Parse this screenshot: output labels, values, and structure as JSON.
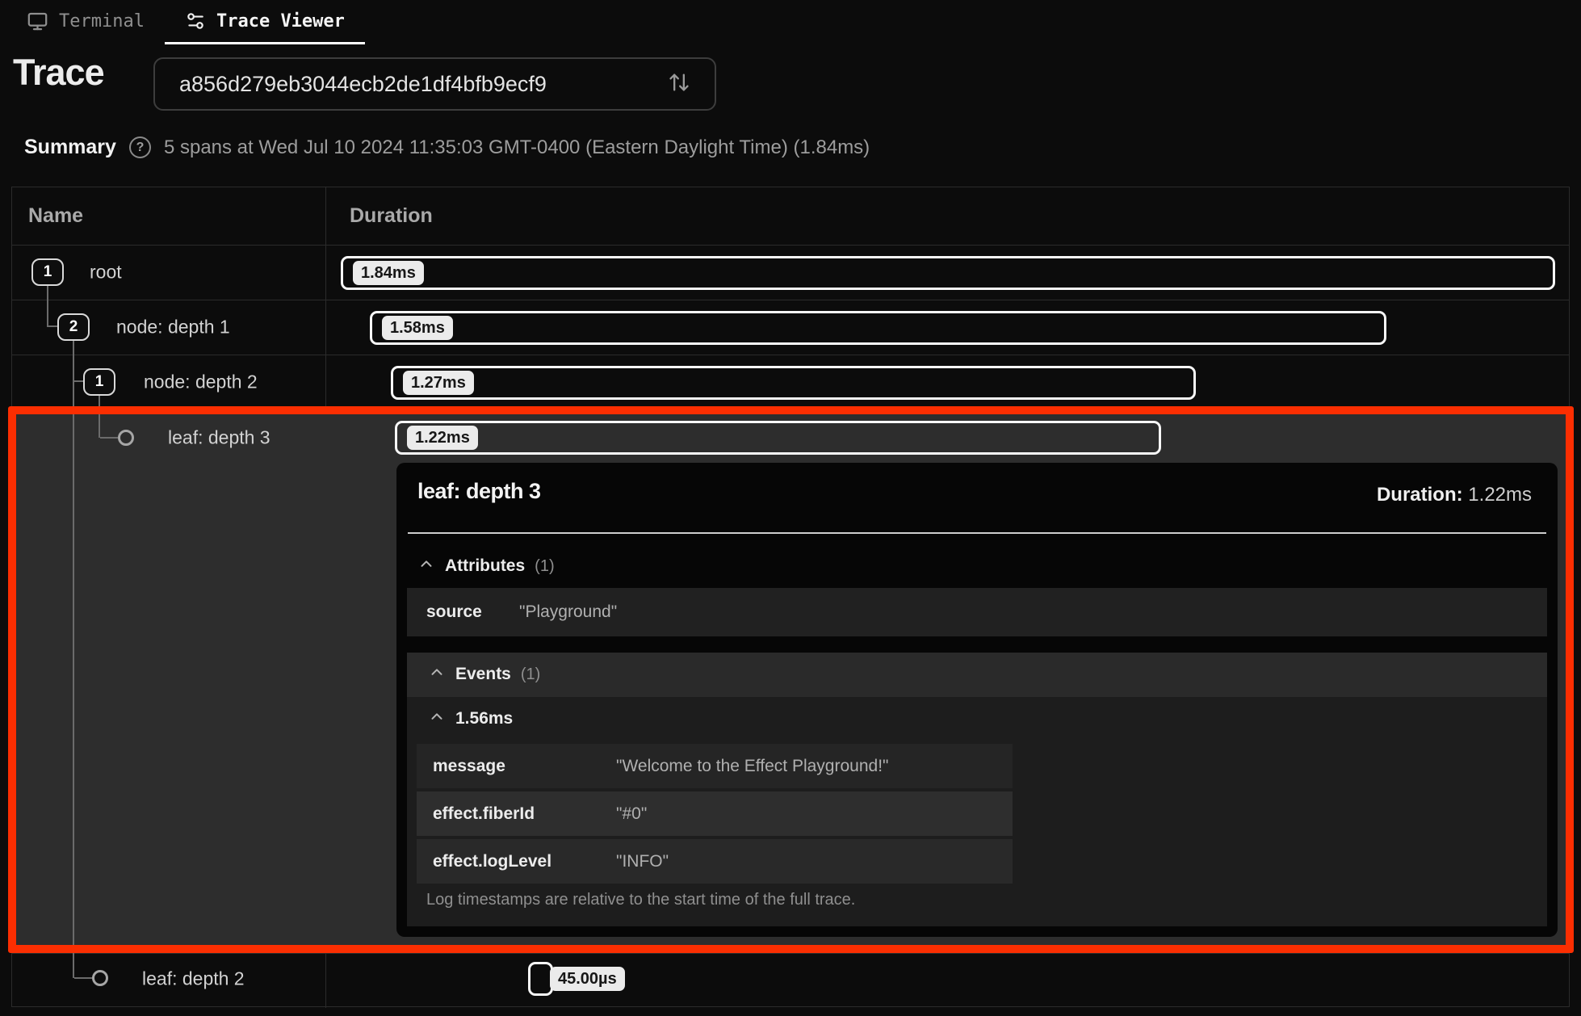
{
  "tabs": {
    "terminal": "Terminal",
    "trace_viewer": "Trace Viewer"
  },
  "trace_header": {
    "title": "Trace",
    "select_value": "a856d279eb3044ecb2de1df4bfb9ecf9"
  },
  "summary": {
    "label": "Summary",
    "help_glyph": "?",
    "text": "5 spans at Wed Jul 10 2024 11:35:03 GMT-0400 (Eastern Daylight Time) (1.84ms)"
  },
  "table": {
    "columns": {
      "name": "Name",
      "duration": "Duration"
    },
    "rows": [
      {
        "badge": "1",
        "label": "root",
        "duration": "1.84ms",
        "depth": 0
      },
      {
        "badge": "2",
        "label": "node: depth 1",
        "duration": "1.58ms",
        "depth": 1
      },
      {
        "badge": "1",
        "label": "node: depth 2",
        "duration": "1.27ms",
        "depth": 2
      },
      {
        "badge": "",
        "label": "leaf: depth 3",
        "duration": "1.22ms",
        "depth": 3,
        "selected": true
      },
      {
        "badge": "",
        "label": "leaf: depth 2",
        "duration": "45.00µs",
        "depth": 2
      }
    ]
  },
  "detail_panel": {
    "title": "leaf: depth 3",
    "duration_label": "Duration:",
    "duration_value": "1.22ms",
    "attributes": {
      "title": "Attributes",
      "count": "(1)",
      "rows": [
        {
          "key": "source",
          "value": "\"Playground\""
        }
      ]
    },
    "events": {
      "title": "Events",
      "count": "(1)",
      "event_time": "1.56ms",
      "rows": [
        {
          "key": "message",
          "value": "\"Welcome to the Effect Playground!\""
        },
        {
          "key": "effect.fiberId",
          "value": "\"#0\""
        },
        {
          "key": "effect.logLevel",
          "value": "\"INFO\""
        }
      ],
      "footnote": "Log timestamps are relative to the start time of the full trace."
    }
  },
  "colors": {
    "annotation": "#fb2e01",
    "bar_border": "#f7f7f7",
    "selected_row_bg": "#2d2d2d"
  }
}
